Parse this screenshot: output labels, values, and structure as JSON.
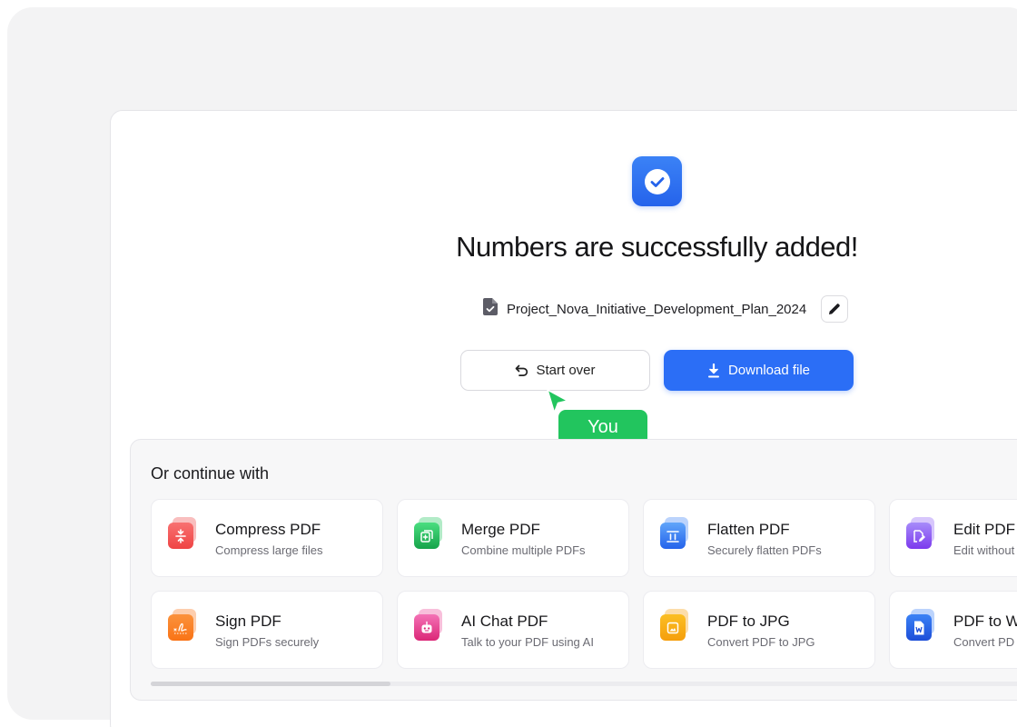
{
  "status": {
    "title": "Numbers are successfully added!",
    "file_name": "Project_Nova_Initiative_Development_Plan_2024"
  },
  "actions": {
    "start_over": "Start over",
    "download": "Download file"
  },
  "cursor": {
    "label": "You"
  },
  "continue_section": {
    "title": "Or continue with",
    "tools": [
      {
        "name": "Compress PDF",
        "desc": "Compress large files",
        "icon": "compress-icon",
        "color": "#ef4444"
      },
      {
        "name": "Merge PDF",
        "desc": "Combine multiple PDFs",
        "icon": "merge-icon",
        "color": "#22c55e"
      },
      {
        "name": "Flatten PDF",
        "desc": "Securely flatten PDFs",
        "icon": "flatten-icon",
        "color": "#3b82f6"
      },
      {
        "name": "Edit PDF",
        "desc": "Edit without",
        "icon": "edit-pdf-icon",
        "color": "#8b5cf6"
      },
      {
        "name": "Sign PDF",
        "desc": "Sign PDFs securely",
        "icon": "signature-icon",
        "color": "#f97316"
      },
      {
        "name": "AI Chat PDF",
        "desc": "Talk to your PDF using AI",
        "icon": "ai-chat-icon",
        "color": "#ec4899"
      },
      {
        "name": "PDF to JPG",
        "desc": "Convert PDF to JPG",
        "icon": "image-icon",
        "color": "#f59e0b"
      },
      {
        "name": "PDF to W",
        "desc": "Convert PD",
        "icon": "word-icon",
        "color": "#2563eb"
      }
    ]
  },
  "colors": {
    "primary": "#2b6ef6",
    "success": "#22c55e"
  }
}
